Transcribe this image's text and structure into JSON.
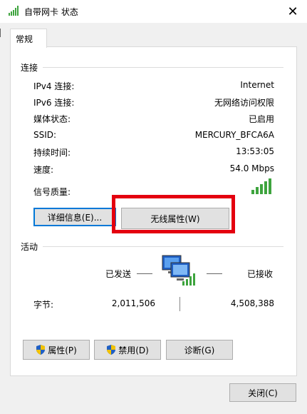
{
  "window": {
    "title": "自带网卡 状态",
    "close_label": "✕"
  },
  "tabs": [
    {
      "label": "常规"
    }
  ],
  "connection": {
    "section_label": "连接",
    "rows": [
      {
        "label": "IPv4 连接:",
        "value": "Internet"
      },
      {
        "label": "IPv6 连接:",
        "value": "无网络访问权限"
      },
      {
        "label": "媒体状态:",
        "value": "已启用"
      },
      {
        "label": "SSID:",
        "value": "MERCURY_BFCA6A"
      },
      {
        "label": "持续时间:",
        "value": "13:53:05"
      },
      {
        "label": "速度:",
        "value": "54.0 Mbps"
      }
    ],
    "signal_label": "信号质量:",
    "signal_bars": 5,
    "signal_bars_filled": 5,
    "details_button": "详细信息(E)...",
    "wireless_props_button": "无线属性(W)"
  },
  "activity": {
    "section_label": "活动",
    "sent_label": "已发送",
    "received_label": "已接收",
    "bytes_label": "字节:",
    "bytes_sent": "2,011,506",
    "bytes_received": "4,508,388"
  },
  "bottom_buttons": {
    "properties": "属性(P)",
    "disable": "禁用(D)",
    "diagnose": "诊断(G)"
  },
  "footer": {
    "close_button": "关闭(C)"
  },
  "colors": {
    "highlight_border": "#e4000f",
    "focus_border": "#0078d7",
    "signal_green": "#3ea43e"
  },
  "icons": {
    "title": "signal-bars-icon",
    "network": "network-computers-icon",
    "shield": "uac-shield-icon"
  }
}
